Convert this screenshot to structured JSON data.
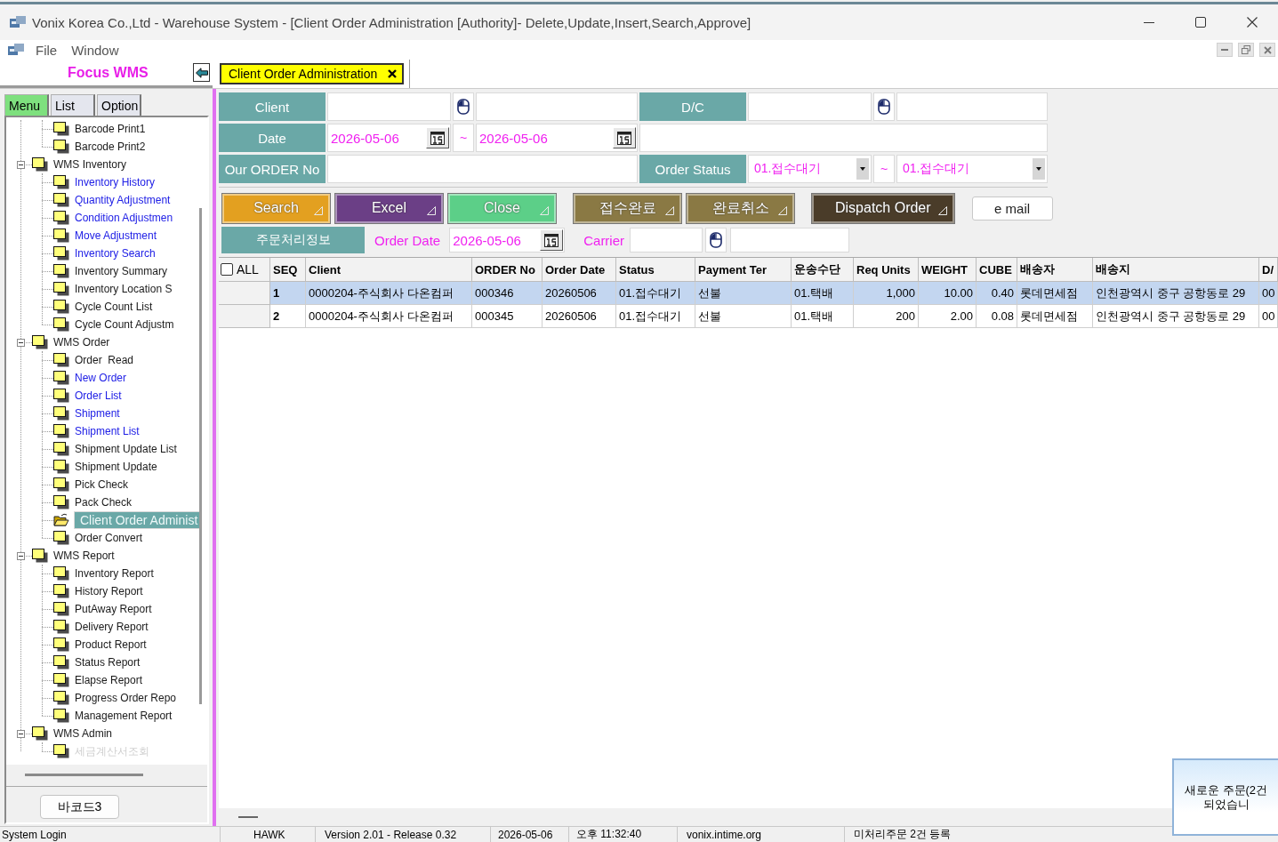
{
  "window": {
    "title": "Vonix Korea Co.,Ltd - Warehouse System - [Client Order Administration [Authority]- Delete,Update,Insert,Search,Approve]"
  },
  "menu_bar": [
    "File",
    "Window"
  ],
  "sidebar": {
    "brand": "Focus WMS",
    "tabs": [
      {
        "label": "Menu",
        "selected": true
      },
      {
        "label": "List",
        "selected": false
      },
      {
        "label": "Option",
        "selected": false
      }
    ],
    "tree": [
      {
        "children": [
          {
            "label": "Barcode Print1",
            "highlighted": false,
            "selected": false
          },
          {
            "label": "Barcode Print2",
            "highlighted": false,
            "selected": false
          }
        ]
      },
      {
        "label": "WMS Inventory",
        "expanded": true,
        "selected": false,
        "children": [
          {
            "label": "Inventory History",
            "highlighted": true,
            "selected": false
          },
          {
            "label": "Quantity Adjustment",
            "highlighted": true,
            "selected": false
          },
          {
            "label": "Condition Adjustmen",
            "highlighted": true,
            "selected": false
          },
          {
            "label": "Move Adjustment",
            "highlighted": true,
            "selected": false
          },
          {
            "label": "Inventory Search",
            "highlighted": true,
            "selected": false
          },
          {
            "label": "Inventory Summary",
            "highlighted": false,
            "selected": false
          },
          {
            "label": "Inventory Location S",
            "highlighted": false,
            "selected": false
          },
          {
            "label": "Cycle Count List",
            "highlighted": false,
            "selected": false
          },
          {
            "label": "Cycle Count Adjustm",
            "highlighted": false,
            "selected": false
          }
        ]
      },
      {
        "label": "WMS Order",
        "expanded": true,
        "selected": false,
        "children": [
          {
            "label": "Order  Read",
            "highlighted": false,
            "selected": false
          },
          {
            "label": "New Order",
            "highlighted": true,
            "selected": false
          },
          {
            "label": "Order List",
            "highlighted": true,
            "selected": false
          },
          {
            "label": "Shipment",
            "highlighted": true,
            "selected": false
          },
          {
            "label": "Shipment List",
            "highlighted": true,
            "selected": false
          },
          {
            "label": "Shipment Update List",
            "highlighted": false,
            "selected": false
          },
          {
            "label": "Shipment Update",
            "highlighted": false,
            "selected": false
          },
          {
            "label": "Pick Check",
            "highlighted": false,
            "selected": false
          },
          {
            "label": "Pack Check",
            "highlighted": false,
            "selected": false
          },
          {
            "label": "Client Order Administ",
            "highlighted": false,
            "selected": true
          },
          {
            "label": "Order Convert",
            "highlighted": false,
            "selected": false
          }
        ]
      },
      {
        "label": "WMS Report",
        "expanded": true,
        "selected": false,
        "children": [
          {
            "label": "Inventory Report",
            "highlighted": false,
            "selected": false
          },
          {
            "label": "History Report",
            "highlighted": false,
            "selected": false
          },
          {
            "label": "PutAway Report",
            "highlighted": false,
            "selected": false
          },
          {
            "label": "Delivery Report",
            "highlighted": false,
            "selected": false
          },
          {
            "label": "Product Report",
            "highlighted": false,
            "selected": false
          },
          {
            "label": "Status Report",
            "highlighted": false,
            "selected": false
          },
          {
            "label": "Elapse Report",
            "highlighted": false,
            "selected": false
          },
          {
            "label": "Progress Order Repo",
            "highlighted": false,
            "selected": false
          },
          {
            "label": "Management Report",
            "highlighted": false,
            "selected": false
          }
        ]
      },
      {
        "label": "WMS Admin",
        "expanded": true,
        "selected": false,
        "children": [
          {
            "label": "세금계산서조회",
            "disabled": true,
            "selected": false
          }
        ]
      }
    ],
    "button": "바코드3"
  },
  "document_tabs": [
    {
      "label": "Client Order Administration",
      "selected": true
    }
  ],
  "filter_form": {
    "rows": [
      [
        {
          "kind": "lookup",
          "label": "Client"
        },
        {
          "kind": "lookup",
          "label": "D/C"
        }
      ],
      [
        {
          "kind": "date_range",
          "label": "Date",
          "from": "2026-05-06",
          "separator": "~",
          "to": "2026-05-06"
        }
      ],
      [
        {
          "kind": "text",
          "label": "Our ORDER No"
        },
        {
          "kind": "select_range",
          "label": "Order Status",
          "from": "01.접수대기",
          "separator": "~",
          "to": "01.접수대기"
        }
      ]
    ]
  },
  "button_groups": [
    [
      {
        "kind": "colored",
        "label": "Search",
        "color": "#e3a020"
      },
      {
        "kind": "colored",
        "label": "Excel",
        "color": "#6b3f86"
      },
      {
        "kind": "colored",
        "label": "Close",
        "color": "#5ccf88"
      }
    ],
    [
      {
        "kind": "colored",
        "label": "접수완료",
        "color": "#8a7944"
      },
      {
        "kind": "colored",
        "label": "완료취소",
        "color": "#8a7944"
      }
    ],
    [
      {
        "kind": "colored",
        "label": "Dispatch Order",
        "color": "#4a3c29"
      }
    ],
    [
      {
        "kind": "plain",
        "label": "e mail"
      }
    ]
  ],
  "order_info": {
    "section": "주문처리정보",
    "order_date_label": "Order Date",
    "order_date": "2026-05-06",
    "carrier_label": "Carrier"
  },
  "table": {
    "select_all": {
      "label": "ALL",
      "checked": false
    },
    "columns": [
      "SEQ",
      "Client",
      "ORDER No",
      "Order Date",
      "Status",
      "Payment Ter",
      "운송수단",
      "Req Units",
      "WEIGHT",
      "CUBE",
      "배송자",
      "배송지",
      "D/"
    ],
    "rows": [
      {
        "selected": true,
        "cells": [
          "1",
          "0000204-주식회사 다온컴퍼",
          "000346",
          "20260506",
          "01.접수대기",
          "선불",
          "01.택배",
          "1,000",
          "10.00",
          "0.40",
          "롯데면세점",
          "인천광역시 중구 공항동로 29",
          "00"
        ]
      },
      {
        "selected": false,
        "cells": [
          "2",
          "0000204-주식회사 다온컴퍼",
          "000345",
          "20260506",
          "01.접수대기",
          "선불",
          "01.택배",
          "200",
          "2.00",
          "0.08",
          "롯데면세점",
          "인천광역시 중구 공항동로 29",
          "00"
        ]
      }
    ]
  },
  "status_bar": [
    "System Login",
    "HAWK",
    "Version 2.01 - Release 0.32",
    "2026-05-06",
    "오후 11:32:40",
    "vonix.intime.org",
    "미처리주문 2건 등록"
  ],
  "notification": {
    "lines": [
      "새로운 주문(2건",
      "되었습니"
    ]
  }
}
